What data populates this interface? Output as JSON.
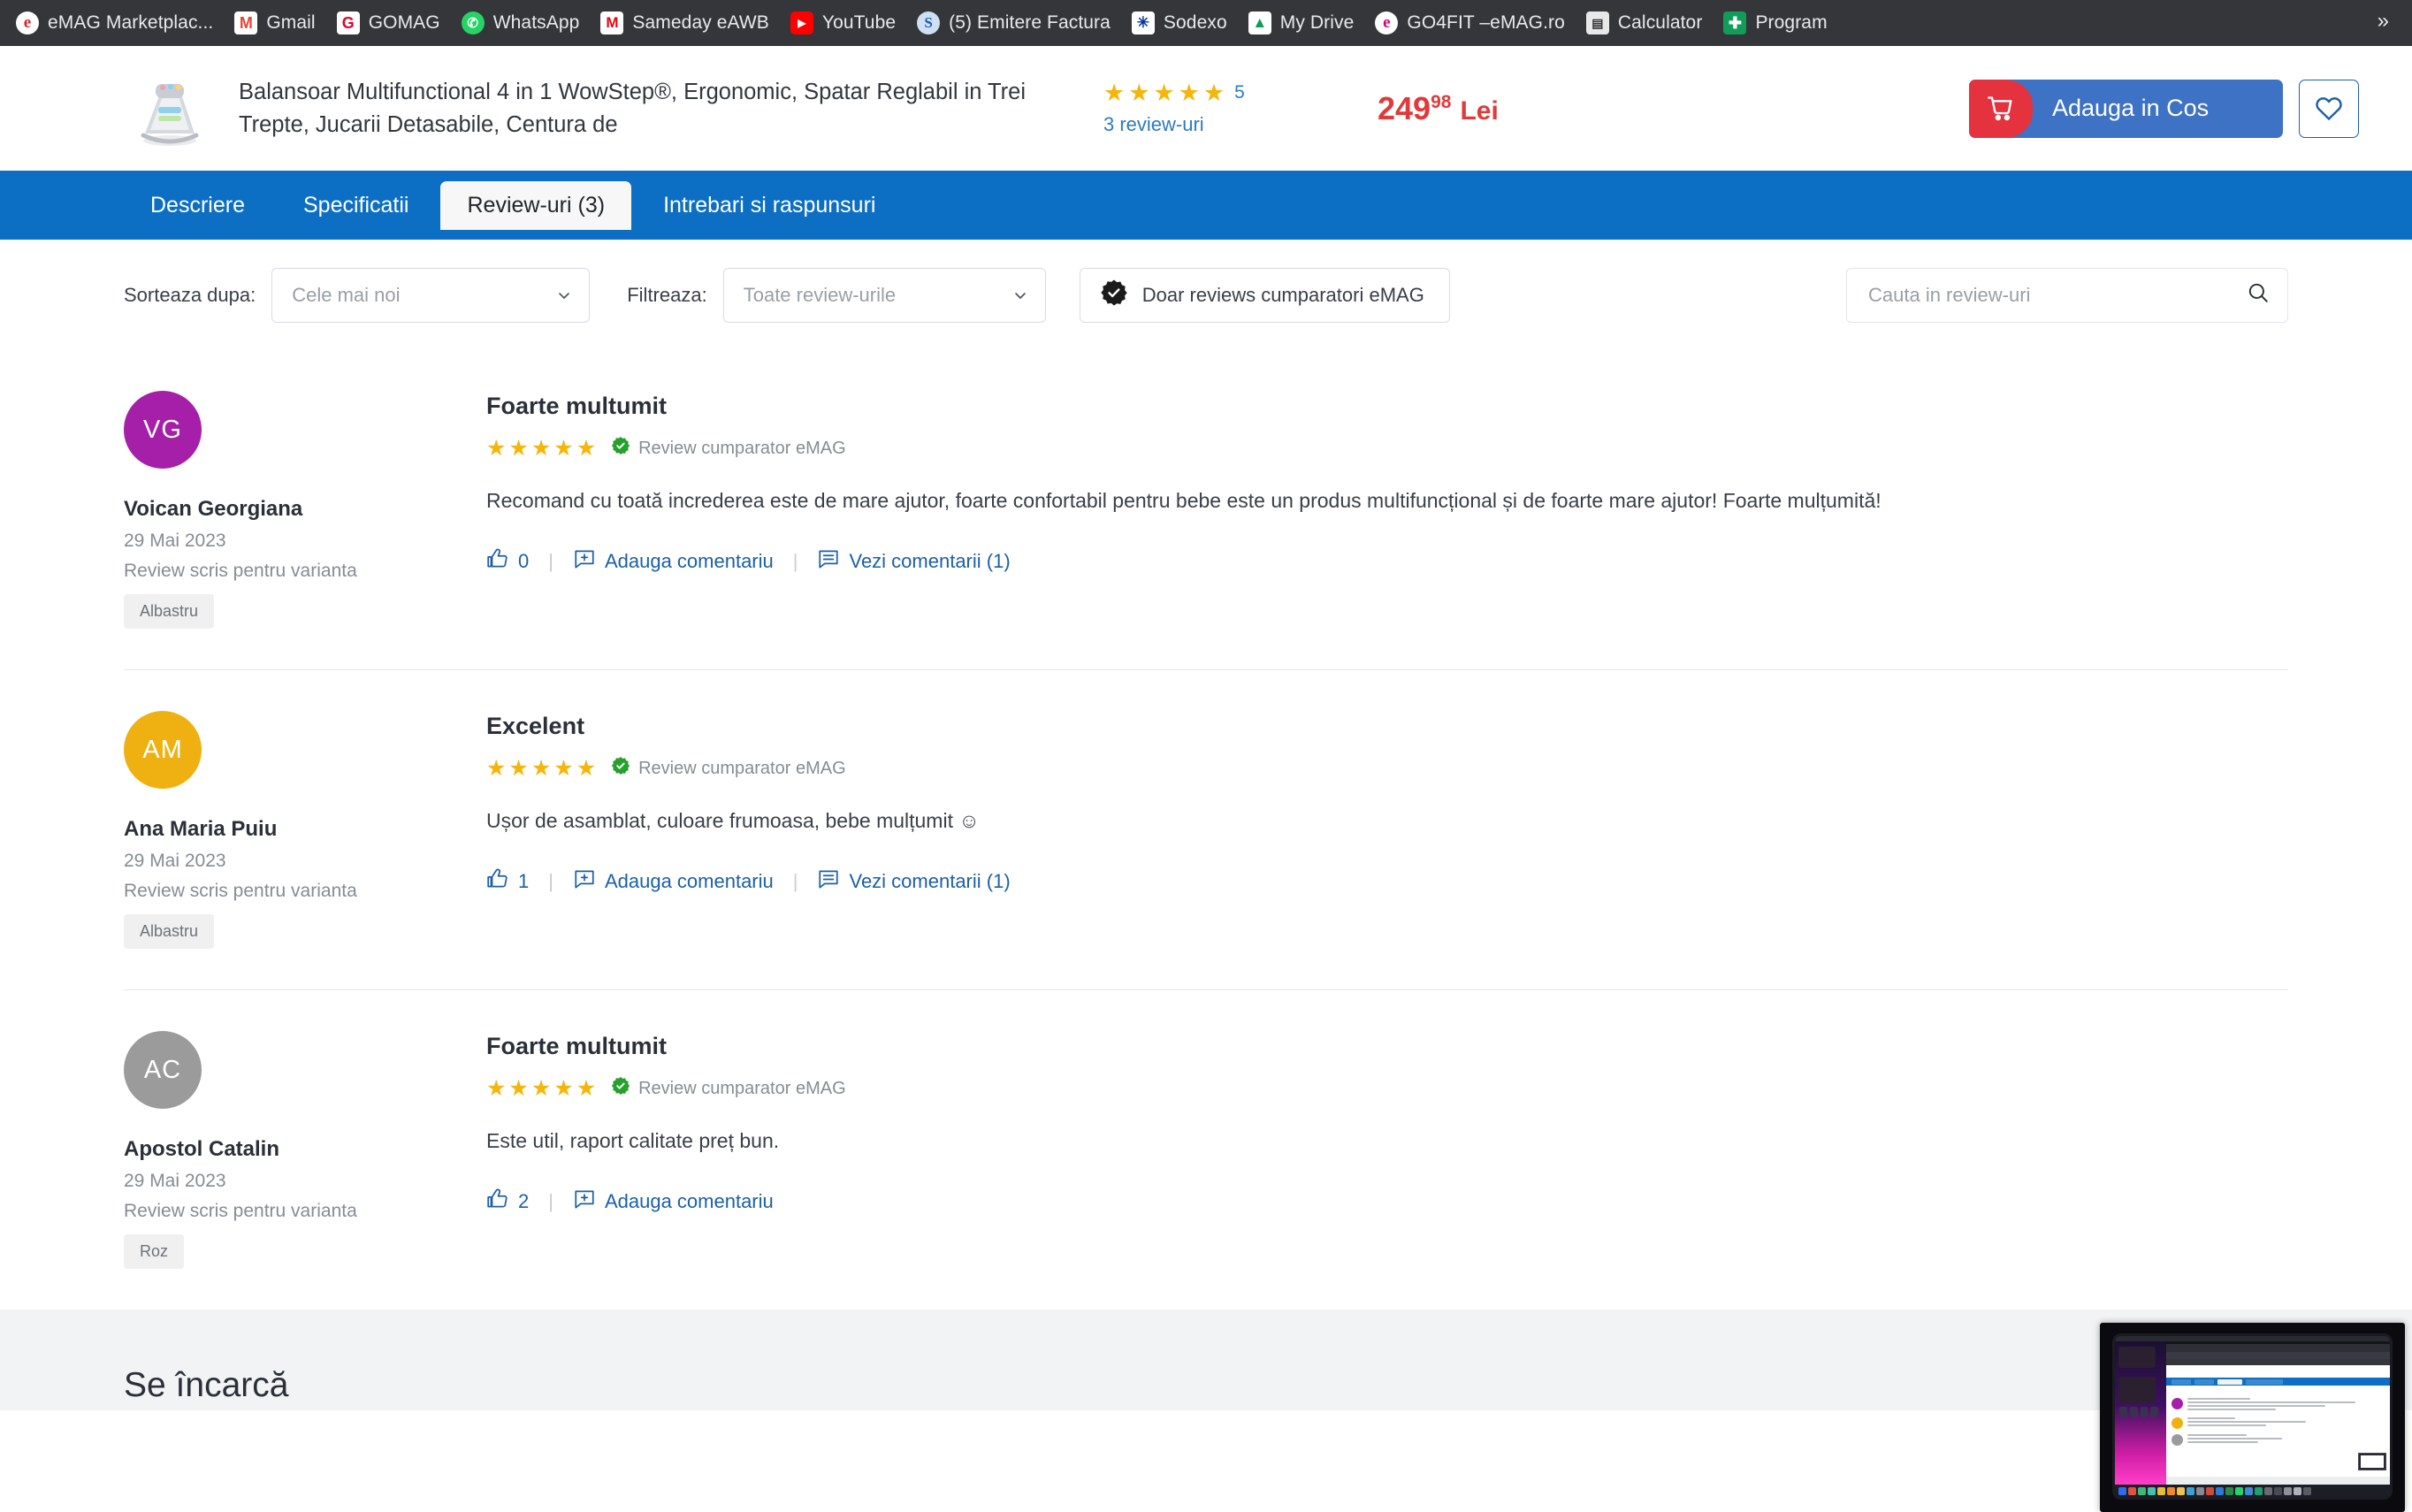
{
  "bookmarks": {
    "items": [
      {
        "label": "eMAG Marketplac...",
        "icon": "emag-icon",
        "glyph": "e",
        "cls": "ico-emag"
      },
      {
        "label": "Gmail",
        "icon": "gmail-icon",
        "glyph": "M",
        "cls": "ico-gmail"
      },
      {
        "label": "GOMAG",
        "icon": "gomag-icon",
        "glyph": "G",
        "cls": "ico-gomag"
      },
      {
        "label": "WhatsApp",
        "icon": "whatsapp-icon",
        "glyph": "✆",
        "cls": "ico-wa"
      },
      {
        "label": "Sameday eAWB",
        "icon": "sameday-icon",
        "glyph": "M",
        "cls": "ico-sameday"
      },
      {
        "label": "YouTube",
        "icon": "youtube-icon",
        "glyph": "▶",
        "cls": "ico-yt"
      },
      {
        "label": "(5) Emitere Factura",
        "icon": "smartbill-icon",
        "glyph": "S",
        "cls": "ico-s"
      },
      {
        "label": "Sodexo",
        "icon": "sodexo-icon",
        "glyph": "✳",
        "cls": "ico-sodexo"
      },
      {
        "label": "My Drive",
        "icon": "google-drive-icon",
        "glyph": "▲",
        "cls": "ico-drive"
      },
      {
        "label": "GO4FIT –eMAG.ro",
        "icon": "go4fit-icon",
        "glyph": "e",
        "cls": "ico-go4fit"
      },
      {
        "label": "Calculator",
        "icon": "calculator-icon",
        "glyph": "▤",
        "cls": "ico-calc"
      },
      {
        "label": "Program",
        "icon": "program-icon",
        "glyph": "✚",
        "cls": "ico-prog"
      }
    ],
    "overflow_label": "»"
  },
  "product": {
    "title": "Balansoar Multifunctional 4 in 1 WowStep®, Ergonomic, Spatar Reglabil in Trei Trepte, Jucarii Detasabile, Centura de",
    "rating_value": "5",
    "stars": 5,
    "reviews_link": "3 review-uri",
    "price_int": "249",
    "price_dec": "98",
    "price_currency": "Lei",
    "add_to_cart_label": "Adauga in Cos",
    "colors": {
      "cart_red": "#e4333f",
      "cart_blue": "#3d72c4",
      "price_red": "#e03a3a",
      "star_gold": "#f5b50a",
      "nav_blue": "#0d6fc4",
      "link_blue": "#1c5fa8"
    }
  },
  "tabs": [
    {
      "label": "Descriere",
      "active": false
    },
    {
      "label": "Specificatii",
      "active": false
    },
    {
      "label": "Review-uri (3)",
      "active": true
    },
    {
      "label": "Intrebari si raspunsuri",
      "active": false
    }
  ],
  "filters": {
    "sort_label": "Sorteaza dupa:",
    "sort_value": "Cele mai noi",
    "filter_label": "Filtreaza:",
    "filter_value": "Toate review-urile",
    "verified_chip": "Doar reviews cumparatori eMAG",
    "search_placeholder": "Cauta in review-uri"
  },
  "reviews": [
    {
      "initials": "VG",
      "avatar_color": "#a51fa8",
      "name": "Voican Georgiana",
      "date": "29 Mai 2023",
      "variant_label": "Review scris pentru varianta",
      "variant": "Albastru",
      "title": "Foarte multumit",
      "stars": 5,
      "verified": "Review cumparator eMAG",
      "text": "Recomand cu toată increderea este de mare ajutor, foarte confortabil pentru bebe este un produs multifuncțional și de foarte mare ajutor! Foarte mulțumită!",
      "likes": "0",
      "add_comment_label": "Adauga comentariu",
      "view_comments_label": "Vezi comentarii (1)",
      "has_view_comments": true
    },
    {
      "initials": "AM",
      "avatar_color": "#efb111",
      "name": "Ana Maria Puiu",
      "date": "29 Mai 2023",
      "variant_label": "Review scris pentru varianta",
      "variant": "Albastru",
      "title": "Excelent",
      "stars": 5,
      "verified": "Review cumparator eMAG",
      "text": "Ușor de asamblat, culoare frumoasa, bebe mulțumit ☺",
      "likes": "1",
      "add_comment_label": "Adauga comentariu",
      "view_comments_label": "Vezi comentarii (1)",
      "has_view_comments": true
    },
    {
      "initials": "AC",
      "avatar_color": "#9b9b9b",
      "name": "Apostol Catalin",
      "date": "29 Mai 2023",
      "variant_label": "Review scris pentru varianta",
      "variant": "Roz",
      "title": "Foarte multumit",
      "stars": 5,
      "verified": "Review cumparator eMAG",
      "text": "Este util, raport calitate preț bun.",
      "likes": "2",
      "add_comment_label": "Adauga comentariu",
      "view_comments_label": "",
      "has_view_comments": false
    }
  ],
  "footer": {
    "loading_text": "Se încarcă"
  },
  "selfview": {
    "name": "screen-share-self-view"
  }
}
